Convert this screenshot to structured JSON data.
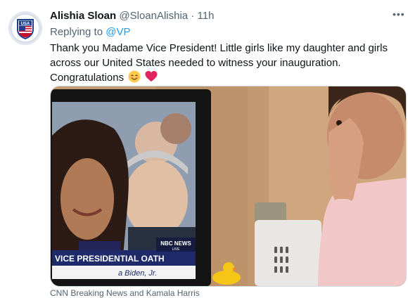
{
  "tweet": {
    "author_name": "Alishia Sloan",
    "author_handle": "@SloanAlishia",
    "separator": "·",
    "timestamp": "11h",
    "more_label": "•••",
    "replying_prefix": "Replying to",
    "replying_handle": "@VP",
    "text": "Thank you Madame Vice President! Little girls like my daughter and girls across our United States needed to witness your inauguration. Congratulations",
    "emojis": [
      "smiling-face-emoji",
      "red-heart-emoji"
    ]
  },
  "avatar": {
    "badge_text": "USA"
  },
  "media": {
    "tv_banner": "VICE PRESIDENTIAL OATH",
    "tv_subtext": "a Biden, Jr.",
    "network": "NBC NEWS",
    "live_label": "LIVE"
  },
  "card": {
    "caption": "CNN Breaking News and Kamala Harris"
  },
  "colors": {
    "link": "#1d9bf0",
    "secondary_text": "#536471",
    "heart": "#e0245e",
    "banner": "#1f2a6b"
  }
}
